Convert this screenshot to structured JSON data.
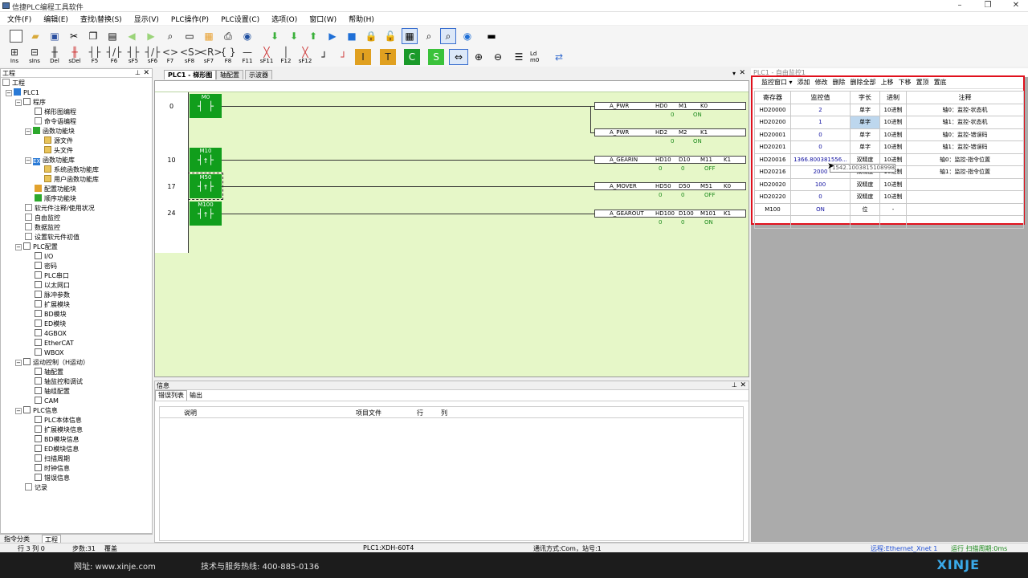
{
  "app": {
    "title": "信捷PLC编程工具软件",
    "accent": "#119e1c",
    "highlight": "#e0101c"
  },
  "menu": [
    "文件(F)",
    "编辑(E)",
    "查找\\替换(S)",
    "显示(V)",
    "PLC操作(P)",
    "PLC设置(C)",
    "选项(O)",
    "窗口(W)",
    "帮助(H)"
  ],
  "toolbar2": [
    {
      "label": "Ins",
      "icon": "ins-contact-icon"
    },
    {
      "label": "sIns",
      "icon": "sins-icon"
    },
    {
      "label": "Del",
      "icon": "del-icon"
    },
    {
      "label": "sDel",
      "icon": "sdel-icon"
    },
    {
      "label": "F5",
      "icon": "no-contact-icon"
    },
    {
      "label": "F6",
      "icon": "nc-contact-icon"
    },
    {
      "label": "sF5",
      "icon": "parallel-no-icon"
    },
    {
      "label": "sF6",
      "icon": "parallel-nc-icon"
    },
    {
      "label": "F7",
      "icon": "coil-icon"
    },
    {
      "label": "sF8",
      "icon": "set-coil-icon"
    },
    {
      "label": "sF7",
      "icon": "reset-coil-icon"
    },
    {
      "label": "F8",
      "icon": "instruction-icon"
    },
    {
      "label": "F11",
      "icon": "hline-icon"
    },
    {
      "label": "sF11",
      "icon": "hline-delete-icon"
    },
    {
      "label": "F12",
      "icon": "vline-icon"
    },
    {
      "label": "sF12",
      "icon": "vline-delete-icon"
    }
  ],
  "project": {
    "header": "工程",
    "tree": [
      {
        "label": "工程",
        "icon": "project-icon"
      },
      {
        "label": "PLC1",
        "icon": "plc-icon"
      },
      {
        "label": "程序",
        "icon": "program-icon"
      },
      {
        "label": "梯形图编程",
        "icon": "ladder-icon"
      },
      {
        "label": "命令语编程",
        "icon": "command-icon"
      },
      {
        "label": "函数功能块",
        "icon": "function-block-icon"
      },
      {
        "label": "源文件",
        "icon": "folder-icon"
      },
      {
        "label": "头文件",
        "icon": "folder-icon"
      },
      {
        "label": "函数功能库",
        "icon": "function-lib-icon"
      },
      {
        "label": "系统函数功能库",
        "icon": "folder-icon"
      },
      {
        "label": "用户函数功能库",
        "icon": "folder-icon"
      },
      {
        "label": "配置功能块",
        "icon": "config-block-icon"
      },
      {
        "label": "顺序功能块",
        "icon": "sequence-block-icon"
      },
      {
        "label": "软元件注释/使用状况",
        "icon": "comment-icon"
      },
      {
        "label": "自由监控",
        "icon": "free-monitor-icon"
      },
      {
        "label": "数据监控",
        "icon": "data-monitor-icon"
      },
      {
        "label": "设置软元件初值",
        "icon": "initial-value-icon"
      },
      {
        "label": "PLC配置",
        "icon": "plc-config-icon"
      },
      {
        "label": "I/O",
        "icon": "io-icon"
      },
      {
        "label": "密码",
        "icon": "password-icon"
      },
      {
        "label": "PLC串口",
        "icon": "serial-port-icon"
      },
      {
        "label": "以太网口",
        "icon": "ethernet-icon"
      },
      {
        "label": "脉冲参数",
        "icon": "pulse-icon"
      },
      {
        "label": "扩展模块",
        "icon": "expansion-icon"
      },
      {
        "label": "BD模块",
        "icon": "bd-icon"
      },
      {
        "label": "ED模块",
        "icon": "ed-icon"
      },
      {
        "label": "4GBOX",
        "icon": "4gbox-icon"
      },
      {
        "label": "EtherCAT",
        "icon": "ethercat-icon"
      },
      {
        "label": "WBOX",
        "icon": "wbox-icon"
      },
      {
        "label": "运动控制（H运动）",
        "icon": "motion-icon"
      },
      {
        "label": "轴配置",
        "icon": "axis-config-icon"
      },
      {
        "label": "轴监控和调试",
        "icon": "axis-debug-icon"
      },
      {
        "label": "轴组配置",
        "icon": "axis-group-icon"
      },
      {
        "label": "CAM",
        "icon": "cam-icon"
      },
      {
        "label": "PLC信息",
        "icon": "plc-info-icon"
      },
      {
        "label": "PLC本体信息",
        "icon": "plc-body-icon"
      },
      {
        "label": "扩展模块信息",
        "icon": "expansion-info-icon"
      },
      {
        "label": "BD模块信息",
        "icon": "bd-info-icon"
      },
      {
        "label": "ED模块信息",
        "icon": "ed-info-icon"
      },
      {
        "label": "扫描周期",
        "icon": "scan-cycle-icon"
      },
      {
        "label": "时钟信息",
        "icon": "clock-icon"
      },
      {
        "label": "错误信息",
        "icon": "error-icon"
      },
      {
        "label": "记录",
        "icon": "record-icon"
      }
    ],
    "tabs": [
      "指令分类",
      "工程"
    ]
  },
  "doc_tabs": [
    "PLC1 - 梯形图",
    "轴配置",
    "示波器"
  ],
  "ladder": {
    "rows": [
      "0",
      "10",
      "17",
      "24"
    ],
    "contacts": [
      {
        "label": "M0",
        "symbol": "┤ ├"
      },
      {
        "label": "M10",
        "symbol": "┤↑├"
      },
      {
        "label": "M50",
        "symbol": "┤↑├"
      },
      {
        "label": "M100",
        "symbol": "┤↑├"
      }
    ],
    "instructions": [
      {
        "name": "A_PWR",
        "a1": "HD0",
        "a2": "M1",
        "a3": "K0",
        "v1": "0",
        "v2": "ON",
        "v3": ""
      },
      {
        "name": "A_PWR",
        "a1": "HD2",
        "a2": "M2",
        "a3": "K1",
        "v1": "0",
        "v2": "ON",
        "v3": ""
      },
      {
        "name": "A_GEARIN",
        "a1": "HD10",
        "a2": "D10",
        "a3": "M11",
        "a4": "K1",
        "v1": "0",
        "v2": "0",
        "v3": "OFF"
      },
      {
        "name": "A_MOVER",
        "a1": "HD50",
        "a2": "D50",
        "a3": "M51",
        "a4": "K0",
        "v1": "0",
        "v2": "0",
        "v3": "OFF"
      },
      {
        "name": "A_GEAROUT",
        "a1": "HD100",
        "a2": "D100",
        "a3": "M101",
        "a4": "K1",
        "v1": "0",
        "v2": "0",
        "v3": "ON"
      }
    ]
  },
  "monitor": {
    "title": "PLC1 - 自由监控1",
    "toolbar": [
      "监控窗口 ▾",
      "添加",
      "修改",
      "删除",
      "删除全部",
      "上移",
      "下移",
      "置顶",
      "置底"
    ],
    "columns": [
      "寄存器",
      "监控值",
      "字长",
      "进制",
      "注释"
    ],
    "rows": [
      {
        "reg": "HD20000",
        "val": "2",
        "len": "单字",
        "base": "10进制",
        "note": "轴0：监控-状态机"
      },
      {
        "reg": "HD20200",
        "val": "1",
        "len": "单字",
        "base": "10进制",
        "note": "轴1：监控-状态机"
      },
      {
        "reg": "HD20001",
        "val": "0",
        "len": "单字",
        "base": "10进制",
        "note": "轴0：监控-错误码"
      },
      {
        "reg": "HD20201",
        "val": "0",
        "len": "单字",
        "base": "10进制",
        "note": "轴1：监控-错误码"
      },
      {
        "reg": "HD20016",
        "val": "1366.800381556...",
        "len": "双精度",
        "base": "10进制",
        "note": "轴0：监控-指令位置"
      },
      {
        "reg": "HD20216",
        "val": "2000",
        "len": "双精度",
        "base": "10进制",
        "note": "轴1：监控-指令位置"
      },
      {
        "reg": "HD20020",
        "val": "100",
        "len": "双精度",
        "base": "10进制",
        "note": ""
      },
      {
        "reg": "HD20220",
        "val": "0",
        "len": "双精度",
        "base": "10进制",
        "note": ""
      },
      {
        "reg": "M100",
        "val": "ON",
        "len": "位",
        "base": "-",
        "note": ""
      },
      {
        "reg": "",
        "val": "",
        "len": "",
        "base": "",
        "note": ""
      }
    ],
    "tooltip": "1542.1003815108998"
  },
  "info": {
    "title": "信息",
    "tabs": [
      "错误列表",
      "输出"
    ],
    "columns": [
      "说明",
      "项目文件",
      "行",
      "列"
    ]
  },
  "status": {
    "pos": "行 3 列 0",
    "steps": "步数:31",
    "mode": "覆盖",
    "plc": "PLC1:XDH-60T4",
    "comm": "通讯方式:Com，站号:1",
    "link": "远程:Ethernet_Xnet 1",
    "run": "运行  扫描周期:0ms"
  },
  "footer": {
    "site": "网址:  www.xinje.com",
    "hotline": "技术与服务热线:  400-885-0136",
    "brand": "XINJE"
  }
}
